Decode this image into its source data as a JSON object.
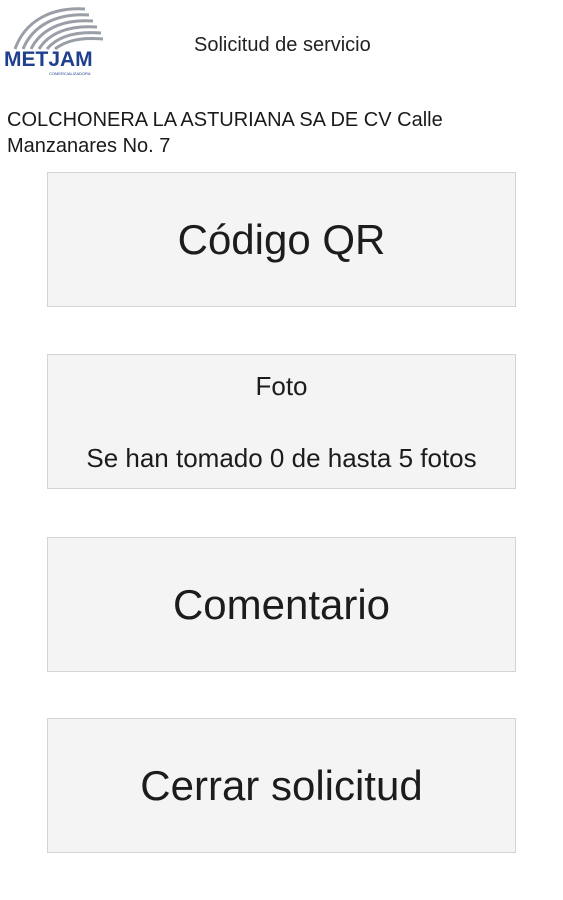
{
  "header": {
    "logo_text": "METJAM",
    "logo_subtext": "COMERCIALIZADORA",
    "title": "Solicitud de servicio"
  },
  "client": {
    "info": "COLCHONERA LA ASTURIANA SA DE CV Calle Manzanares No. 7"
  },
  "actions": {
    "qr_label": "Código QR",
    "photo_label": "Foto",
    "photo_status": "Se han tomado 0 de hasta 5 fotos",
    "comment_label": "Comentario",
    "close_label": "Cerrar solicitud"
  },
  "colors": {
    "logo_blue": "#1f3f8f",
    "logo_swoosh": "#9a9ea6",
    "button_bg": "#f4f4f4",
    "button_border": "#d4d4d4"
  }
}
